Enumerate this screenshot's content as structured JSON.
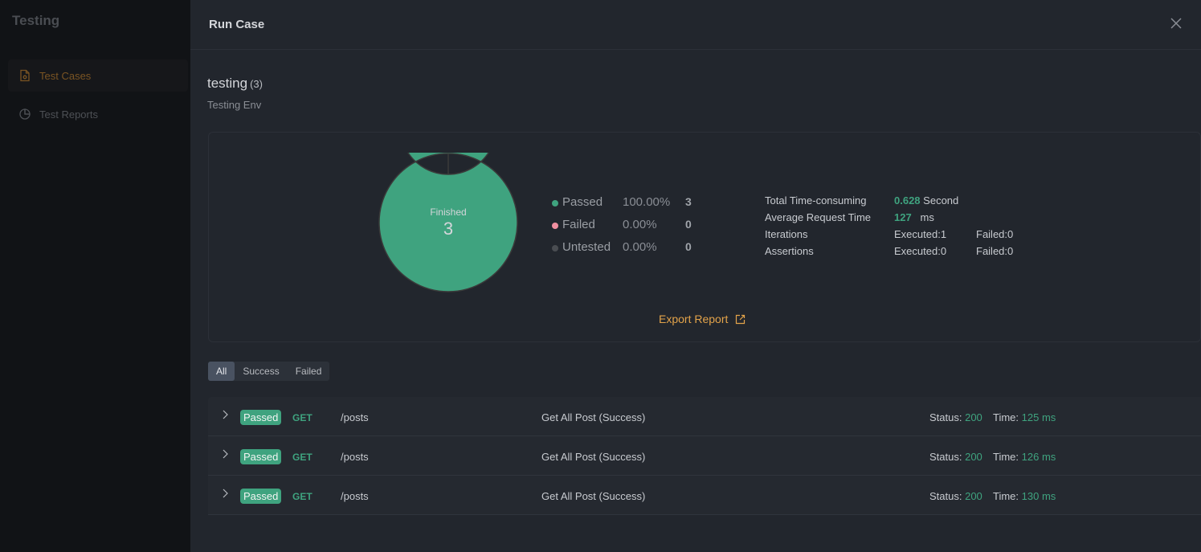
{
  "sidebar": {
    "app_title": "Testing",
    "items": [
      {
        "label": "Test Cases",
        "icon": "file-icon",
        "active": true
      },
      {
        "label": "Test Reports",
        "icon": "pie-chart-icon",
        "active": false
      }
    ]
  },
  "drawer": {
    "title": "Run Case",
    "close_icon": "close-icon",
    "run": {
      "name": "testing",
      "count": "(3)",
      "environment": "Testing Env"
    },
    "summary": {
      "donut": {
        "center_label": "Finished",
        "center_value": "3"
      },
      "legend": [
        {
          "name": "Passed",
          "percent": "100.00%",
          "count": "3",
          "color": "#3fa37f"
        },
        {
          "name": "Failed",
          "percent": "0.00%",
          "count": "0",
          "color": "#f08fa0"
        },
        {
          "name": "Untested",
          "percent": "0.00%",
          "count": "0",
          "color": "#4a4d52"
        }
      ],
      "stats": {
        "total_time": {
          "label": "Total Time-consuming",
          "value": "0.628",
          "unit": "Second"
        },
        "avg_request_time": {
          "label": "Average Request Time",
          "value": "127",
          "unit": "ms"
        },
        "iterations": {
          "label": "Iterations",
          "executed": "Executed:1",
          "failed": "Failed:0"
        },
        "assertions": {
          "label": "Assertions",
          "executed": "Executed:0",
          "failed": "Failed:0"
        }
      },
      "export_label": "Export Report"
    },
    "filters": [
      {
        "label": "All",
        "active": true
      },
      {
        "label": "Success",
        "active": false
      },
      {
        "label": "Failed",
        "active": false
      }
    ],
    "results": [
      {
        "badge": "Passed",
        "method": "GET",
        "path": "/posts",
        "name": "Get All Post (Success)",
        "status_label": "Status:",
        "status": "200",
        "time_label": "Time:",
        "time": "125 ms"
      },
      {
        "badge": "Passed",
        "method": "GET",
        "path": "/posts",
        "name": "Get All Post (Success)",
        "status_label": "Status:",
        "status": "200",
        "time_label": "Time:",
        "time": "126 ms"
      },
      {
        "badge": "Passed",
        "method": "GET",
        "path": "/posts",
        "name": "Get All Post (Success)",
        "status_label": "Status:",
        "status": "200",
        "time_label": "Time:",
        "time": "130 ms"
      }
    ]
  },
  "chart_data": {
    "type": "pie",
    "title": "Finished",
    "categories": [
      "Passed",
      "Failed",
      "Untested"
    ],
    "values": [
      3,
      0,
      0
    ],
    "total": 3,
    "colors": [
      "#3fa37f",
      "#f08fa0",
      "#4a4d52"
    ]
  }
}
